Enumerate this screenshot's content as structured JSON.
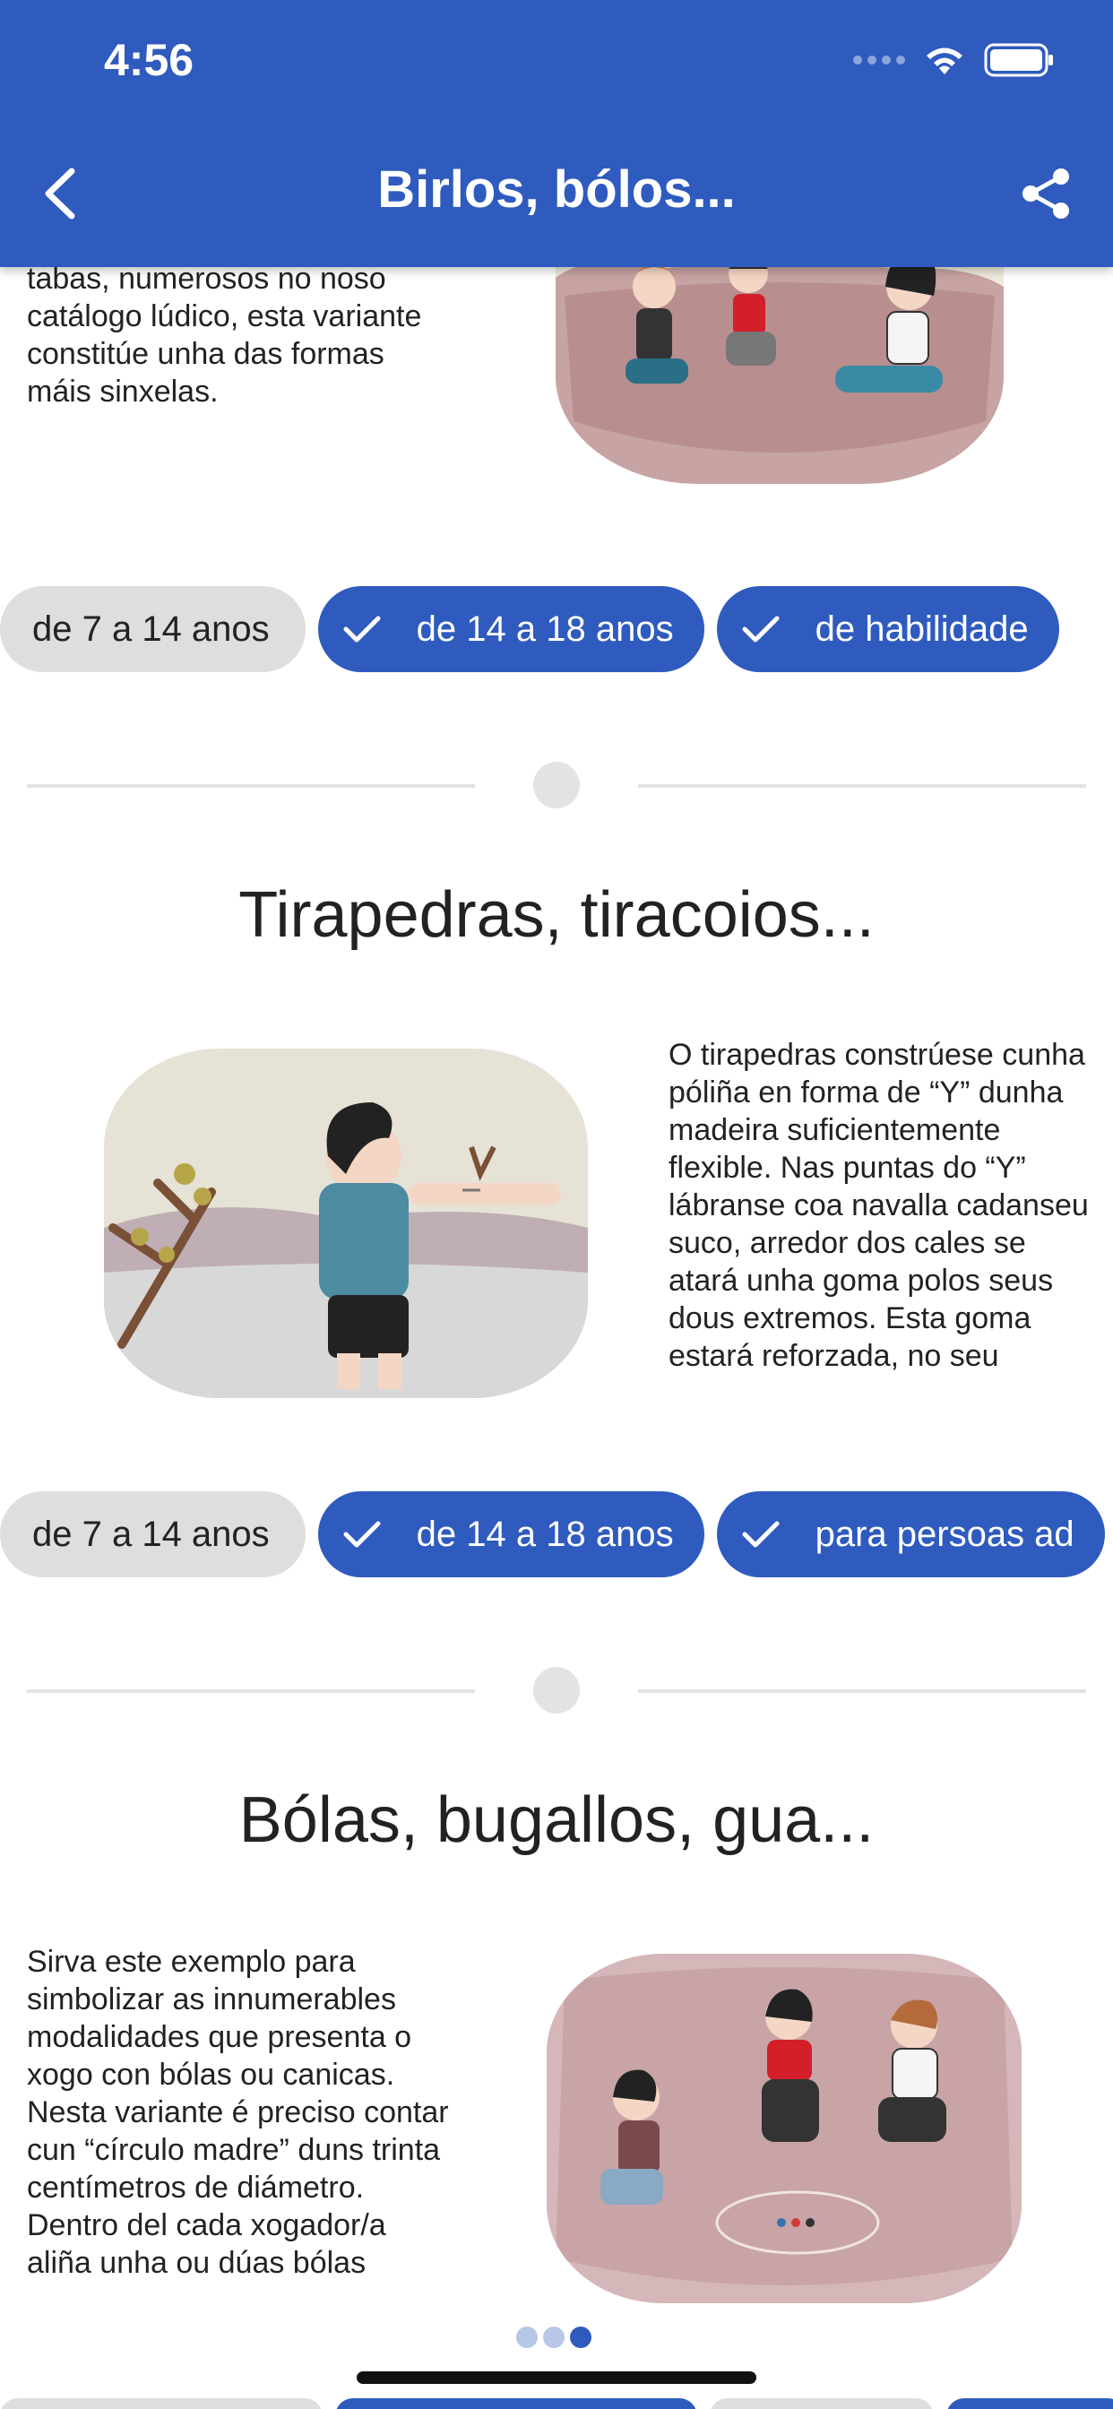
{
  "status_bar": {
    "time": "4:56"
  },
  "header": {
    "title": "Birlos, bólos..."
  },
  "colors": {
    "primary": "#2f5bbf",
    "chip_off": "#dedede",
    "divider": "#e3e3e3"
  },
  "sections": [
    {
      "text": "tabas, numerosos no noso catálogo lúdico, esta variante constitúe unha das formas máis sinxelas.",
      "chips": [
        {
          "label": "de 7 a 14 anos",
          "selected": false
        },
        {
          "label": "de 14 a 18 anos",
          "selected": true
        },
        {
          "label": "de habilidade",
          "selected": true
        }
      ]
    },
    {
      "title": "Tirapedras, tiracoios...",
      "text": "O tirapedras constrúese cunha póliña en forma de “Y” dunha madeira suficientemente flexible. Nas puntas do “Y” lábranse coa navalla cadanseu suco, arredor dos cales se atará unha goma polos seus dous extremos. Esta goma estará reforzada, no seu",
      "chips": [
        {
          "label": "de 7 a 14 anos",
          "selected": false
        },
        {
          "label": "de 14 a 18 anos",
          "selected": true
        },
        {
          "label": "para persoas ad",
          "selected": true
        }
      ]
    },
    {
      "title": "Bólas, bugallos, gua...",
      "text": "Sirva este exemplo para simbolizar as innumerables modalidades que presenta o xogo con bólas ou canicas. Nesta variante é preciso contar cun “círculo madre” duns trinta centímetros de diámetro. Dentro del cada xogador/a aliña unha ou dúas bólas"
    }
  ],
  "icons": {
    "back": "chevron-left-icon",
    "share": "share-icon",
    "check": "check-icon"
  }
}
